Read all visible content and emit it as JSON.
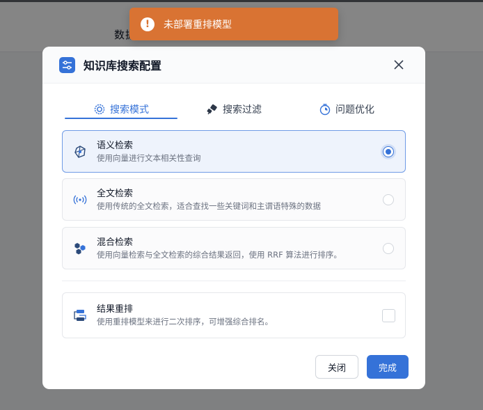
{
  "background": {
    "header_text": "数据"
  },
  "toast": {
    "icon": "exclamation-icon",
    "message": "未部署重排模型",
    "color": "#d97333"
  },
  "modal": {
    "title": "知识库搜索配置",
    "header_icon": "sliders-icon",
    "tabs": [
      {
        "label": "搜索模式",
        "icon": "gear-search-icon",
        "active": true
      },
      {
        "label": "搜索过滤",
        "icon": "filter-plug-icon",
        "active": false
      },
      {
        "label": "问题优化",
        "icon": "timer-icon",
        "active": false
      }
    ],
    "modes": [
      {
        "title": "语义检索",
        "description": "使用向量进行文本相关性查询",
        "icon": "vector-network-icon",
        "selected": true
      },
      {
        "title": "全文检索",
        "description": "使用传统的全文检索，适合查找一些关键词和主谓语特殊的数据",
        "icon": "broadcast-icon",
        "selected": false
      },
      {
        "title": "混合检索",
        "description": "使用向量检索与全文检索的综合结果返回，使用 RRF 算法进行排序。",
        "icon": "hexagon-cluster-icon",
        "selected": false
      }
    ],
    "rerank": {
      "title": "结果重排",
      "description": "使用重排模型来进行二次排序，可增强综合排名。",
      "icon": "rerank-icon",
      "checked": false
    },
    "buttons": {
      "close_label": "关闭",
      "done_label": "完成"
    },
    "accent_color": "#3572d8"
  }
}
